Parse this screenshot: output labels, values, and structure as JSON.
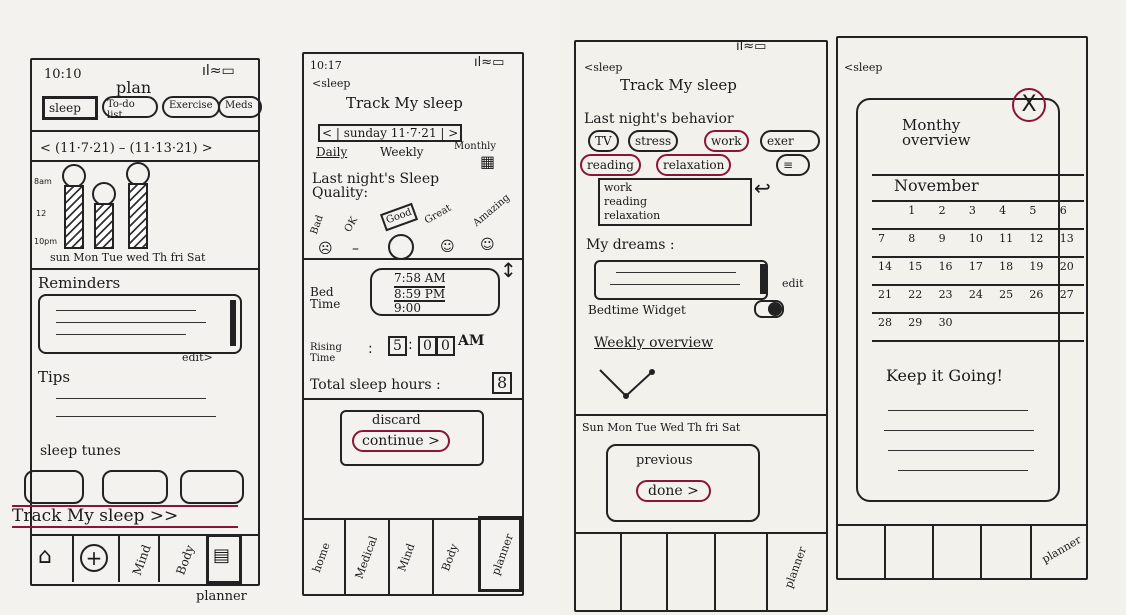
{
  "screen1": {
    "time": "10:10",
    "status": "ıl≈▭",
    "title": "plan",
    "tabs": [
      "sleep",
      "To-do list",
      "Exercise",
      "Meds"
    ],
    "date_range": "< (11·7·21) – (11·13·21) >",
    "y_labels": [
      "8am",
      "12",
      "10pm"
    ],
    "days": "sun Mon Tue wed Th fri Sat",
    "reminders_label": "Reminders",
    "edit_label": "edit>",
    "tips_label": "Tips",
    "sleep_tunes_label": "sleep tunes",
    "track_link": "Track My sleep >>",
    "nav": [
      "home",
      "+",
      "Mind",
      "Body",
      "planner"
    ],
    "planner_caption": "planner"
  },
  "screen2": {
    "time": "10:17",
    "status": "ıl≈▭",
    "back": "<sleep",
    "title": "Track My sleep",
    "date_selector": "< | sunday 11·7·21 | >",
    "views": [
      "Daily",
      "Weekly",
      "Monthly"
    ],
    "quality_label": "Last night's Sleep Quality:",
    "quality_options": [
      "Bad",
      "OK",
      "Good",
      "Great",
      "Amazing"
    ],
    "bed_time_label": "Bed Time",
    "bed_times": [
      "7:58 AM",
      "8:59 PM",
      "9:00"
    ],
    "rising_label": "Rising Time",
    "rising_h": "5",
    "rising_m1": "0",
    "rising_m2": "0",
    "rising_ampm": "AM",
    "total_label": "Total sleep hours :",
    "total_value": "8",
    "discard_label": "discard",
    "continue_label": "continue >",
    "nav": [
      "home",
      "Medical",
      "Mind",
      "Body",
      "planner"
    ]
  },
  "screen3": {
    "status": "ıl≈▭",
    "back": "<sleep",
    "title": "Track My sleep",
    "behavior_label": "Last night's behavior",
    "behaviors": [
      "TV",
      "stress",
      "work",
      "exer",
      "reading",
      "relaxation"
    ],
    "selected_list": [
      "work",
      "reading",
      "relaxation"
    ],
    "dreams_label": "My dreams :",
    "edit_label": "edit",
    "widget_label": "Bedtime Widget",
    "weekly_label": "Weekly overview",
    "days": "Sun Mon Tue Wed Th fri Sat",
    "previous_label": "previous",
    "done_label": "done >",
    "nav": [
      "",
      "",
      "",
      "",
      "planner"
    ]
  },
  "screen4": {
    "back": "<sleep",
    "close": "X",
    "title": "Monthy overview",
    "month": "November",
    "weeks": [
      [
        "",
        "1",
        "2",
        "3",
        "4",
        "5",
        "6"
      ],
      [
        "7",
        "8",
        "9",
        "10",
        "11",
        "12",
        "13"
      ],
      [
        "14",
        "15",
        "16",
        "17",
        "18",
        "19",
        "20"
      ],
      [
        "21",
        "22",
        "23",
        "24",
        "25",
        "26",
        "27"
      ],
      [
        "28",
        "29",
        "30",
        "",
        "",
        "",
        ""
      ]
    ],
    "message": "Keep it Going!",
    "nav": [
      "",
      "",
      "",
      "",
      "planner"
    ]
  }
}
